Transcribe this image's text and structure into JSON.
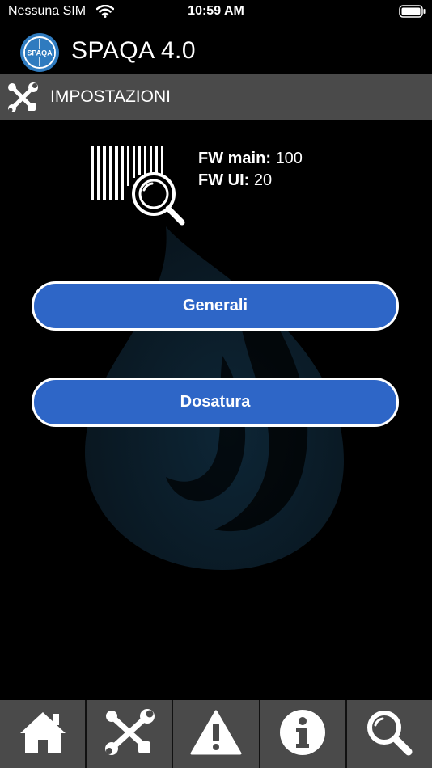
{
  "status_bar": {
    "carrier": "Nessuna SIM",
    "time": "10:59 AM"
  },
  "app": {
    "title": "SPAQA 4.0",
    "logo_text": "SPAQA"
  },
  "section": {
    "title": "IMPOSTAZIONI",
    "icon": "tools-icon"
  },
  "firmware": {
    "main_label": "FW main:",
    "main_value": "100",
    "ui_label": "FW UI:",
    "ui_value": "20"
  },
  "buttons": {
    "generali": "Generali",
    "dosatura": "Dosatura"
  },
  "tabs": [
    {
      "icon": "home-icon"
    },
    {
      "icon": "tools-icon"
    },
    {
      "icon": "warning-icon"
    },
    {
      "icon": "info-icon"
    },
    {
      "icon": "search-icon"
    }
  ],
  "colors": {
    "button": "#2e66c7",
    "section_bar": "#4a4a4a",
    "tab_bar": "#4a4a4a",
    "background": "#000000"
  }
}
